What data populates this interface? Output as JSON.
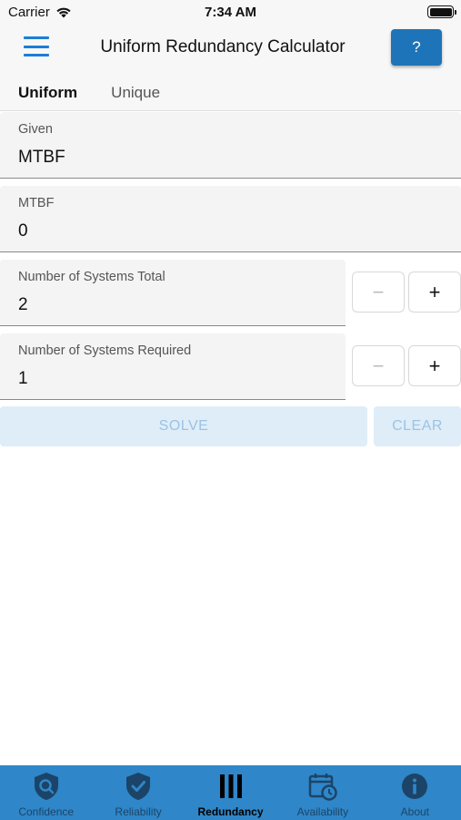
{
  "status": {
    "carrier": "Carrier",
    "time": "7:34 AM"
  },
  "app_bar": {
    "title": "Uniform Redundancy Calculator",
    "help_label": "?"
  },
  "tabs": [
    {
      "label": "Uniform",
      "active": true
    },
    {
      "label": "Unique",
      "active": false
    }
  ],
  "form": {
    "given": {
      "label": "Given",
      "value": "MTBF"
    },
    "mtbf": {
      "label": "MTBF",
      "value": "0"
    },
    "systems_total": {
      "label": "Number of Systems Total",
      "value": "2"
    },
    "systems_required": {
      "label": "Number of Systems Required",
      "value": "1"
    },
    "minus_label": "−",
    "plus_label": "+"
  },
  "actions": {
    "solve_label": "SOLVE",
    "clear_label": "CLEAR"
  },
  "bottom_nav": [
    {
      "label": "Confidence",
      "icon": "shield-search-icon",
      "active": false
    },
    {
      "label": "Reliability",
      "icon": "shield-check-icon",
      "active": false
    },
    {
      "label": "Redundancy",
      "icon": "bars-icon",
      "active": true
    },
    {
      "label": "Availability",
      "icon": "calendar-clock-icon",
      "active": false
    },
    {
      "label": "About",
      "icon": "info-icon",
      "active": false
    }
  ],
  "colors": {
    "accent": "#1b7ed6",
    "help_button": "#1e74b8",
    "nav_background": "#2f86c8",
    "nav_inactive": "#1b4468",
    "button_disabled_bg": "#deedf8",
    "button_disabled_text": "#9cc3e4"
  }
}
